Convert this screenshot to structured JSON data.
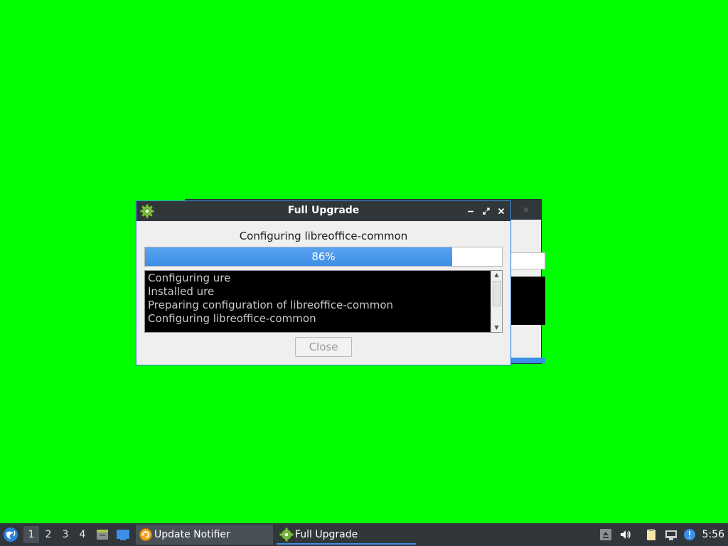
{
  "dialog": {
    "title": "Full Upgrade",
    "status": "Configuring libreoffice-common",
    "progress": {
      "value": 0.86,
      "label": "86%"
    },
    "log_lines": [
      "Configuring ure",
      "Installed ure",
      "Preparing configuration of libreoffice-common",
      "Configuring libreoffice-common"
    ],
    "close_label": "Close"
  },
  "taskbar": {
    "workspaces": [
      "1",
      "2",
      "3",
      "4"
    ],
    "active_workspace": "1",
    "tasks": [
      {
        "label": "Update Notifier",
        "icon": "update-notifier-icon"
      },
      {
        "label": "Full Upgrade",
        "icon": "gear-icon"
      }
    ],
    "clock": "5:56"
  },
  "colors": {
    "desktop": "#00ff00",
    "titlebar": "#31363b",
    "accent": "#3d8ee6"
  }
}
